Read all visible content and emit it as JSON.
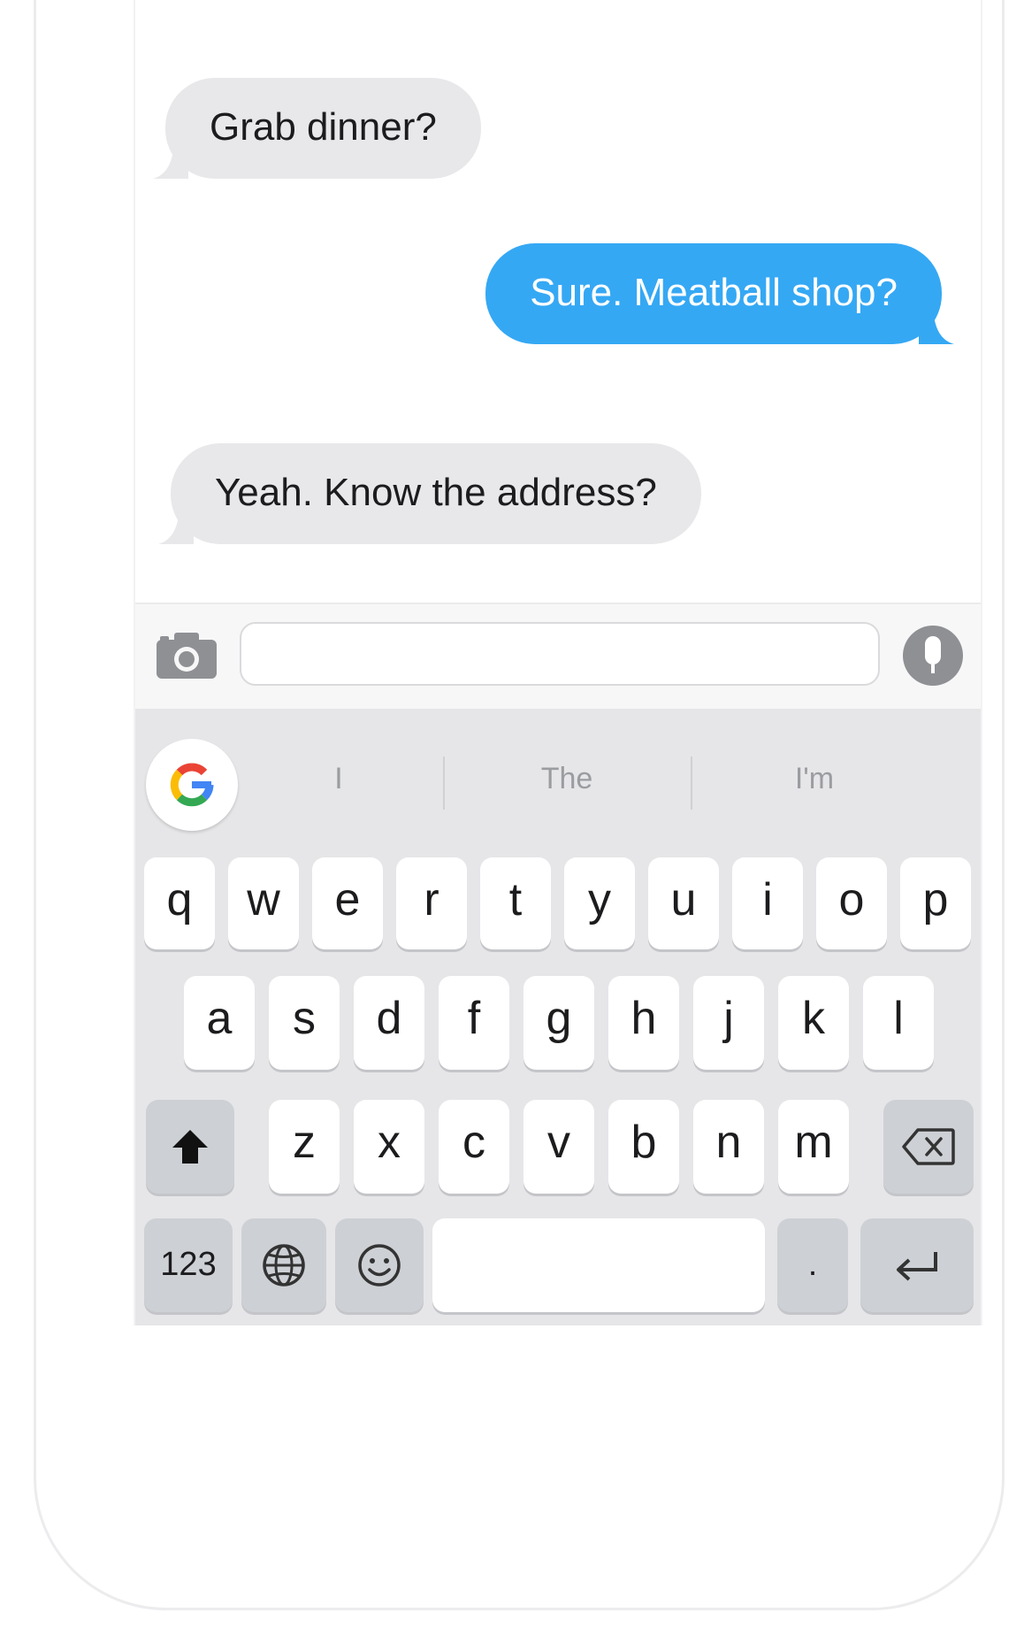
{
  "messages": [
    {
      "direction": "received",
      "text": "Grab dinner?"
    },
    {
      "direction": "sent",
      "text": "Sure. Meatball shop?"
    },
    {
      "direction": "received",
      "text": "Yeah. Know the address?"
    }
  ],
  "input": {
    "value": "",
    "placeholder": ""
  },
  "suggestions": [
    "I",
    "The",
    "I'm"
  ],
  "keyboard": {
    "row1": [
      "q",
      "w",
      "e",
      "r",
      "t",
      "y",
      "u",
      "i",
      "o",
      "p"
    ],
    "row2": [
      "a",
      "s",
      "d",
      "f",
      "g",
      "h",
      "j",
      "k",
      "l"
    ],
    "row3": [
      "z",
      "x",
      "c",
      "v",
      "b",
      "n",
      "m"
    ],
    "numbers_label": "123",
    "period_label": "."
  },
  "icons": {
    "camera": "camera-icon",
    "mic": "mic-icon",
    "google": "google-logo-icon",
    "shift": "shift-icon",
    "backspace": "backspace-icon",
    "globe": "globe-icon",
    "emoji": "emoji-icon",
    "return": "return-icon"
  },
  "colors": {
    "sent_bubble": "#35a8f4",
    "received_bubble": "#e8e8ea",
    "keyboard_bg": "#e6e6e8"
  }
}
